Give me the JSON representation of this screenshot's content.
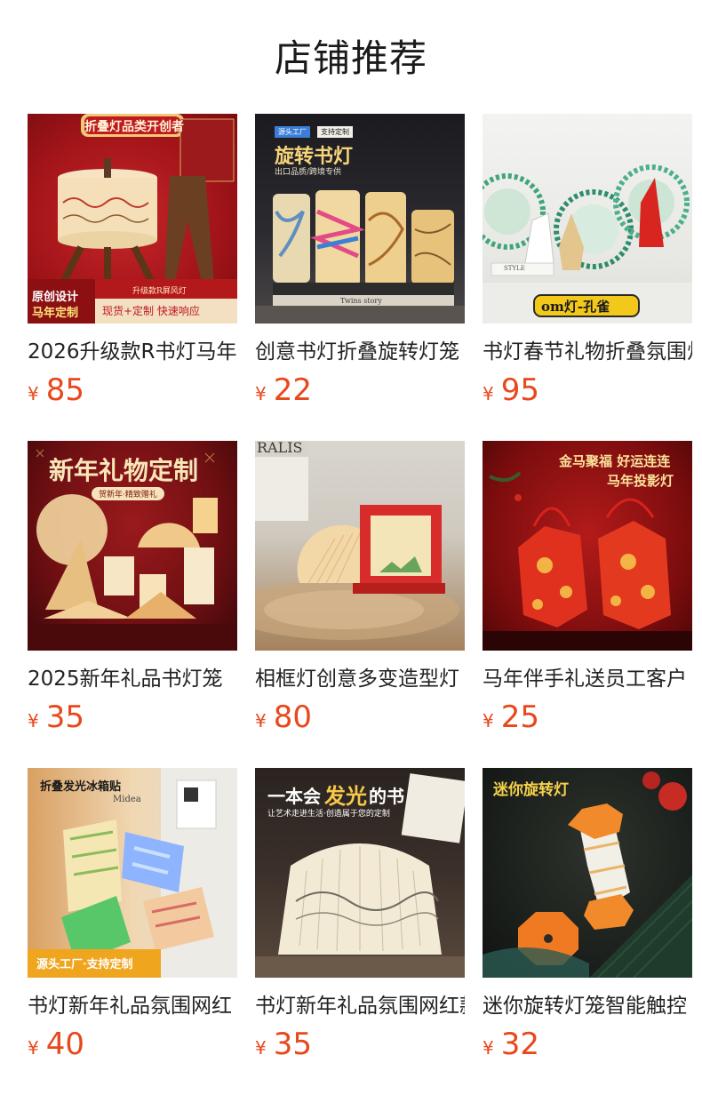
{
  "page": {
    "title": "店铺推荐"
  },
  "theme": {
    "price_color": "#e8481b",
    "title_color": "#1a1a1a",
    "text_color": "#222222"
  },
  "products": [
    {
      "title": "2026升级款R书灯马年",
      "currency": "¥",
      "price": "85",
      "image_text": {
        "banner": "折叠灯品类开创者",
        "sub": "升级款R屏风灯",
        "badge_line1": "原创设计",
        "badge_line2": "马年定制",
        "bottom": "现货+定制  快速响应"
      }
    },
    {
      "title": "创意书灯折叠旋转灯笼",
      "currency": "¥",
      "price": "22",
      "image_text": {
        "pill1": "源头工厂",
        "pill2": "支持定制",
        "headline": "旋转书灯",
        "sub": "出口品质/跨境专供",
        "book_label": "Twins story"
      }
    },
    {
      "title": "书灯春节礼物折叠氛围灯",
      "currency": "¥",
      "price": "95",
      "image_text": {
        "label": "om灯-孔雀",
        "small": "STYLE"
      }
    },
    {
      "title": "2025新年礼品书灯笼",
      "currency": "¥",
      "price": "35",
      "image_text": {
        "headline": "新年礼物定制",
        "sub": "贺新年·精致赠礼"
      }
    },
    {
      "title": "相框灯创意多变造型灯",
      "currency": "¥",
      "price": "80",
      "image_text": {
        "corner": "RALIS"
      }
    },
    {
      "title": "马年伴手礼送员工客户",
      "currency": "¥",
      "price": "25",
      "image_text": {
        "line1": "金马聚福 好运连连",
        "line2": "马年投影灯"
      }
    },
    {
      "title": "书灯新年礼品氛围网红",
      "currency": "¥",
      "price": "40",
      "image_text": {
        "top": "折叠发光冰箱贴",
        "brand": "Midea",
        "bottom": "源头工厂·支持定制"
      }
    },
    {
      "title": "书灯新年礼品氛围网红款",
      "currency": "¥",
      "price": "35",
      "image_text": {
        "headline_a": "一本会",
        "headline_b": "发光",
        "headline_c": "的书",
        "sub": "让艺术走进生活·创造属于您的定制"
      }
    },
    {
      "title": "迷你旋转灯笼智能触控",
      "currency": "¥",
      "price": "32",
      "image_text": {
        "headline": "迷你旋转灯"
      }
    }
  ]
}
